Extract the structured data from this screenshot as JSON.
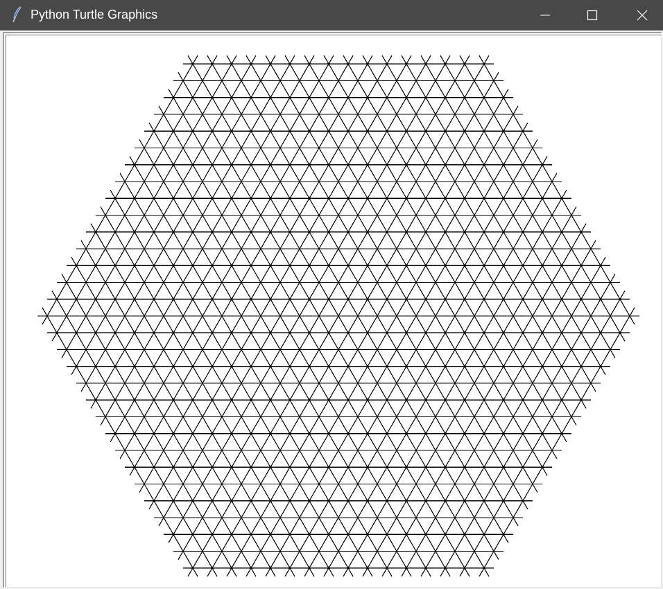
{
  "window": {
    "title": "Python Turtle Graphics",
    "app_icon": "feather-icon",
    "controls": {
      "minimize_icon": "minimize-icon",
      "maximize_icon": "maximize-icon",
      "close_icon": "close-icon"
    },
    "colors": {
      "titlebar": "#484848",
      "title_text": "#ffffff",
      "canvas_background": "#ffffff",
      "drawing": "#000000"
    }
  },
  "drawing": {
    "kind": "hexagonal snowflake fractal",
    "branches_per_node": 6,
    "recursion_depth": 5,
    "branch_length_ratio": 0.5
  }
}
